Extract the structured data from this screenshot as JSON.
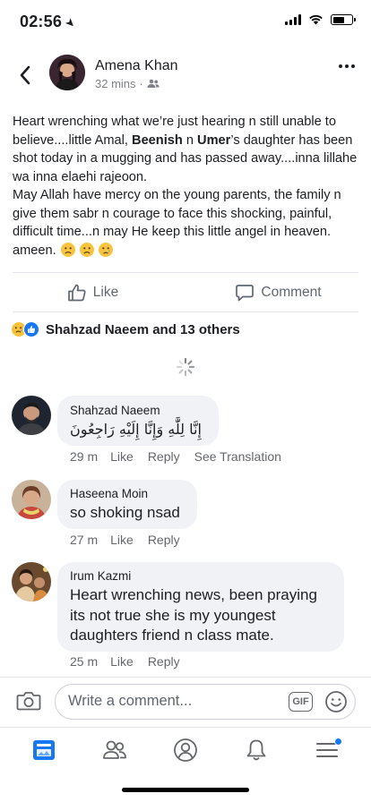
{
  "status_bar": {
    "time": "02:56"
  },
  "post": {
    "author": "Amena Khan",
    "time_ago": "32 mins",
    "separator": "·",
    "text_lines": [
      {
        "type": "plain",
        "text": "Heart wrenching what we’re just hearing n still unable to believe....little Amal, "
      },
      {
        "type": "bold",
        "text": "Beenish"
      },
      {
        "type": "plain",
        "text": " n "
      },
      {
        "type": "bold",
        "text": "Umer"
      },
      {
        "type": "plain",
        "text": "’s daughter has been shot today in a mugging and has passed away....inna lillahe wa inna elaehi rajeoon."
      }
    ],
    "paragraph_2": "May Allah have mercy on the young parents, the family n give them sabr n courage to face this shocking, painful, difficult time...n may He keep this little angel in heaven. ameen."
  },
  "actions": {
    "like_label": "Like",
    "comment_label": "Comment"
  },
  "reactions": {
    "summary": "Shahzad Naeem and 13 others"
  },
  "comments": [
    {
      "name": "Shahzad Naeem",
      "text": "إِنَّا لِلَّٰهِ وَإِنَّا إِلَيْهِ رَاجِعُونَ",
      "time": "29 m",
      "like": "Like",
      "reply": "Reply",
      "translate": "See Translation"
    },
    {
      "name": "Haseena Moin",
      "text": "so shoking nsad",
      "time": "27 m",
      "like": "Like",
      "reply": "Reply"
    },
    {
      "name": "Irum Kazmi",
      "text": "Heart wrenching news, been praying its not true she is my youngest daughters friend n class mate.",
      "time": "25 m",
      "like": "Like",
      "reply": "Reply"
    }
  ],
  "composer": {
    "placeholder": "Write a comment...",
    "gif_label": "GIF"
  },
  "colors": {
    "accent": "#1877f2",
    "bubble": "#f0f2f5",
    "muted": "#65676b"
  }
}
